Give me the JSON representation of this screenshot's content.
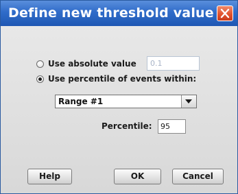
{
  "window": {
    "title": "Define new threshold value"
  },
  "options": {
    "absolute_label": "Use absolute value",
    "absolute_value": "0.1",
    "percentile_label": "Use percentile of events within:",
    "selected": "percentile"
  },
  "range": {
    "selected": "Range #1"
  },
  "percentile": {
    "label": "Percentile:",
    "value": "95"
  },
  "buttons": {
    "help": "Help",
    "ok": "OK",
    "cancel": "Cancel"
  },
  "colors": {
    "titlebar": "#2f6cc9",
    "close": "#e0502c"
  }
}
